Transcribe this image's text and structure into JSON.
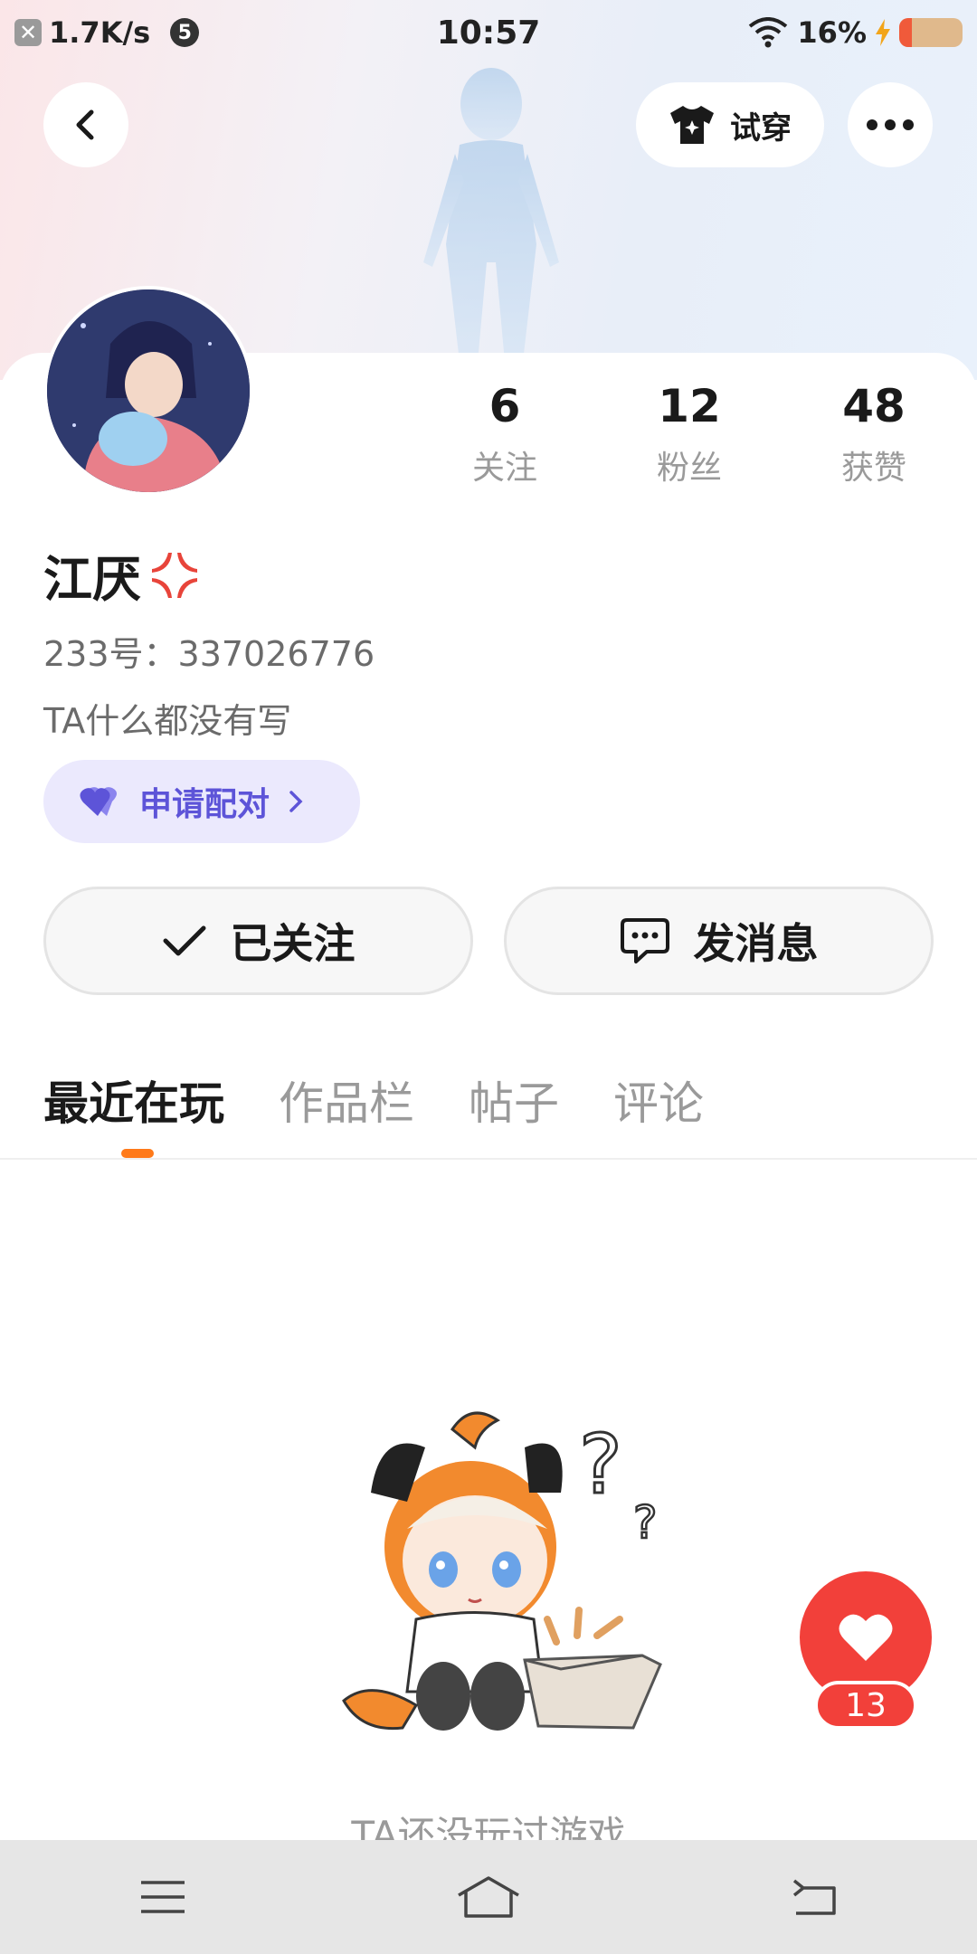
{
  "status_bar": {
    "net_speed": "1.7K/s",
    "notif_count": "5",
    "time": "10:57",
    "battery": "16%"
  },
  "header": {
    "try_on_label": "试穿"
  },
  "profile": {
    "stats": [
      {
        "value": "6",
        "label": "关注"
      },
      {
        "value": "12",
        "label": "粉丝"
      },
      {
        "value": "48",
        "label": "获赞"
      }
    ],
    "name": "江厌",
    "id_line": "233号：337026776",
    "bio": "TA什么都没有写",
    "pair_label": "申请配对"
  },
  "actions": {
    "followed_label": "已关注",
    "message_label": "发消息"
  },
  "tabs": [
    "最近在玩",
    "作品栏",
    "帖子",
    "评论"
  ],
  "empty_state": {
    "text": "TA还没玩过游戏"
  },
  "like": {
    "count": "13"
  },
  "colors": {
    "accent_orange": "#ff7a1a",
    "pair_purple": "#5d54d8",
    "like_red": "#f2403a"
  }
}
